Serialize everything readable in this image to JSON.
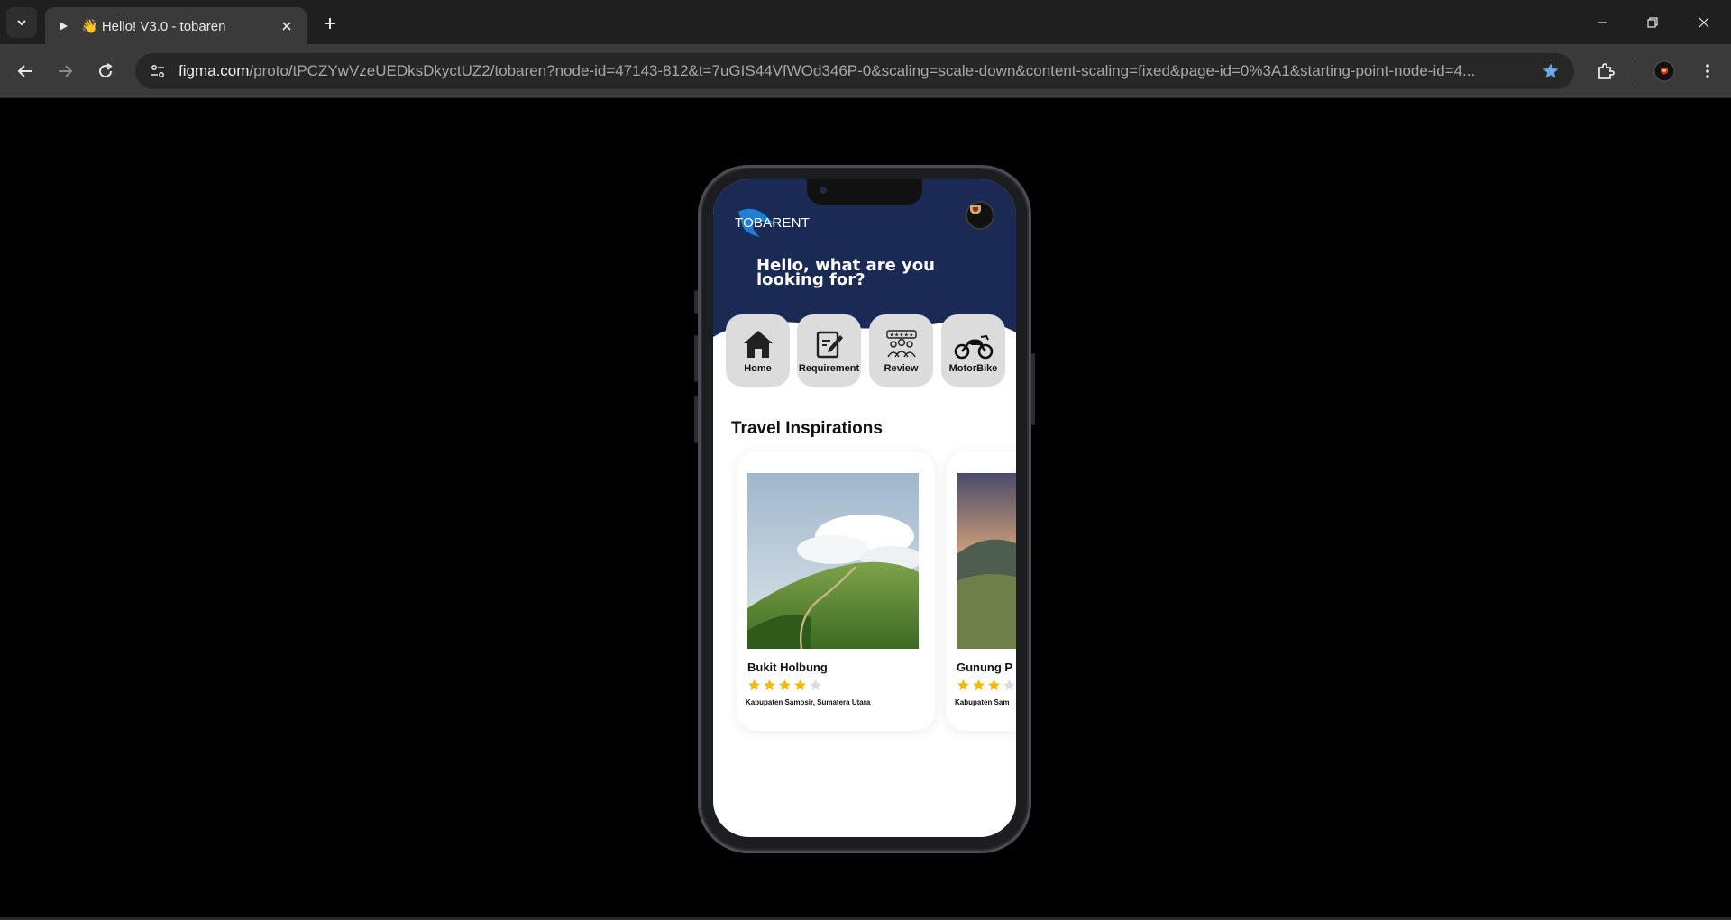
{
  "browser": {
    "tab_title": "👋 Hello! V3.0 - tobaren",
    "url_host": "figma.com",
    "url_path": "/proto/tPCZYwVzeUEDksDkyctUZ2/tobaren?node-id=47143-812&t=7uGIS44VfWOd346P-0&scaling=scale-down&content-scaling=fixed&page-id=0%3A1&starting-point-node-id=4..."
  },
  "app": {
    "brand": "TOBARENT",
    "greeting": "Hello, what are you looking for?",
    "hero_color": "#1b2a55",
    "categories": [
      {
        "label": "Home",
        "icon": "house-icon"
      },
      {
        "label": "Requirement",
        "icon": "document-edit-icon"
      },
      {
        "label": "Review",
        "icon": "review-people-icon"
      },
      {
        "label": "MotorBike",
        "icon": "motorbike-icon"
      }
    ],
    "section_title": "Travel Inspirations",
    "cards": [
      {
        "name": "Bukit Holbung",
        "rating": 4,
        "location": "Kabupaten Samosir, Sumatera Utara"
      },
      {
        "name": "Gunung P",
        "rating": 3,
        "location": "Kabupaten Sam"
      }
    ],
    "star_color": "#f5b800"
  }
}
